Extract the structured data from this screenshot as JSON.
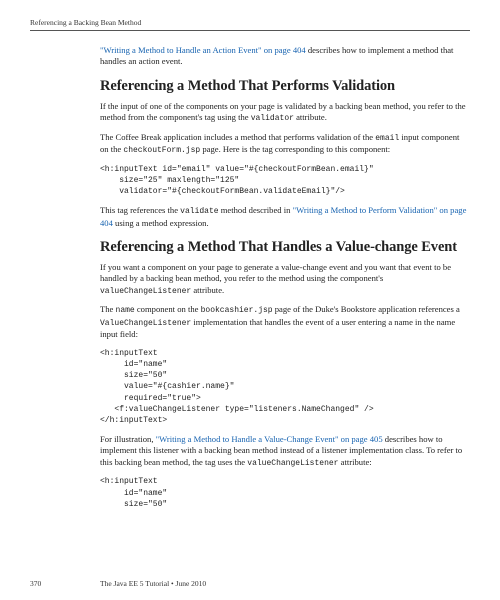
{
  "runningHead": "Referencing a Backing Bean Method",
  "intro": {
    "link": "\"Writing a Method to Handle an Action Event\" on page 404",
    "rest": " describes how to implement a method that handles an action event."
  },
  "sec1": {
    "heading": "Referencing a Method That Performs Validation",
    "p1a": "If the input of one of the components on your page is validated by a backing bean method, you refer to the method from the component's tag using the ",
    "p1code": "validator",
    "p1b": " attribute.",
    "p2a": "The Coffee Break application includes a method that performs validation of the ",
    "p2code1": "email",
    "p2b": " input component on the ",
    "p2code2": "checkoutForm.jsp",
    "p2c": " page. Here is the tag corresponding to this component:",
    "code": "<h:inputText id=\"email\" value=\"#{checkoutFormBean.email}\"\n    size=\"25\" maxlength=\"125\"\n    validator=\"#{checkoutFormBean.validateEmail}\"/>",
    "p3a": "This tag references the ",
    "p3code": "validate",
    "p3b": " method described in ",
    "p3link": "\"Writing a Method to Perform Validation\" on page 404",
    "p3c": " using a method expression."
  },
  "sec2": {
    "heading": "Referencing a Method That Handles a Value-change Event",
    "p1a": "If you want a component on your page to generate a value-change event and you want that event to be handled by a backing bean method, you refer to the method using the component's ",
    "p1code": "valueChangeListener",
    "p1b": " attribute.",
    "p2a": "The ",
    "p2code1": "name",
    "p2b": " component on the ",
    "p2code2": "bookcashier.jsp",
    "p2c": " page of the Duke's Bookstore application references a ",
    "p2code3": "ValueChangeListener",
    "p2d": " implementation that handles the event of a user entering a name in the name input field:",
    "code1": "<h:inputText\n     id=\"name\"\n     size=\"50\"\n     value=\"#{cashier.name}\"\n     required=\"true\">\n   <f:valueChangeListener type=\"listeners.NameChanged\" />\n</h:inputText>",
    "p3a": "For illustration, ",
    "p3link": "\"Writing a Method to Handle a Value-Change Event\" on page 405",
    "p3b": " describes how to implement this listener with a backing bean method instead of a listener implementation class. To refer to this backing bean method, the tag uses the ",
    "p3code": "valueChangeListener",
    "p3c": " attribute:",
    "code2": "<h:inputText\n     id=\"name\"\n     size=\"50\""
  },
  "footer": {
    "pageNum": "370",
    "title": "The Java EE 5 Tutorial  •  June 2010"
  }
}
